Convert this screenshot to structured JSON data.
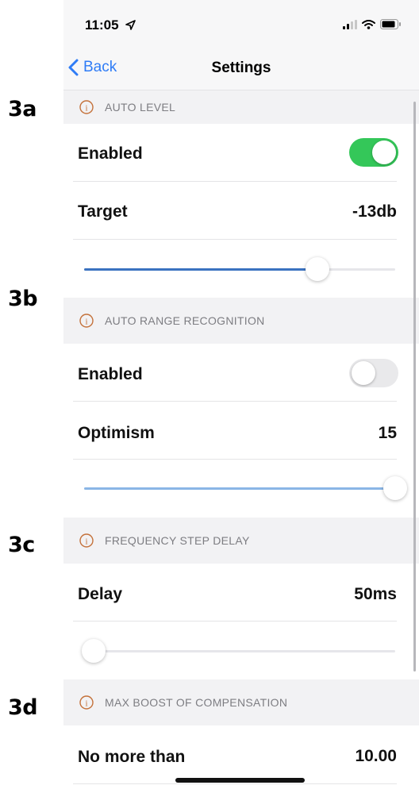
{
  "annotations": [
    "3a",
    "3b",
    "3c",
    "3d"
  ],
  "status_bar": {
    "time": "11:05"
  },
  "nav": {
    "back_label": "Back",
    "title": "Settings"
  },
  "sections": [
    {
      "header": "AUTO LEVEL",
      "toggle": {
        "label": "Enabled",
        "on": true
      },
      "value_row": {
        "label": "Target",
        "value": "-13db"
      },
      "slider": {
        "value": 0.75,
        "color": "#3b72c0"
      }
    },
    {
      "header": "AUTO RANGE RECOGNITION",
      "toggle": {
        "label": "Enabled",
        "on": false
      },
      "value_row": {
        "label": "Optimism",
        "value": "15"
      },
      "slider": {
        "value": 1.0,
        "color": "#8ab6e6"
      }
    },
    {
      "header": "FREQUENCY STEP DELAY",
      "value_row": {
        "label": "Delay",
        "value": "50ms"
      },
      "slider": {
        "value": 0.03,
        "color": "#3b72c0"
      }
    },
    {
      "header": "MAX BOOST OF COMPENSATION",
      "value_row": {
        "label": "No more than",
        "value": "10.00"
      }
    }
  ],
  "colors": {
    "accent": "#2f7cf6",
    "toggle_on": "#34c759",
    "toggle_off": "#e9e9eb",
    "info_icon": "#c4713a"
  }
}
